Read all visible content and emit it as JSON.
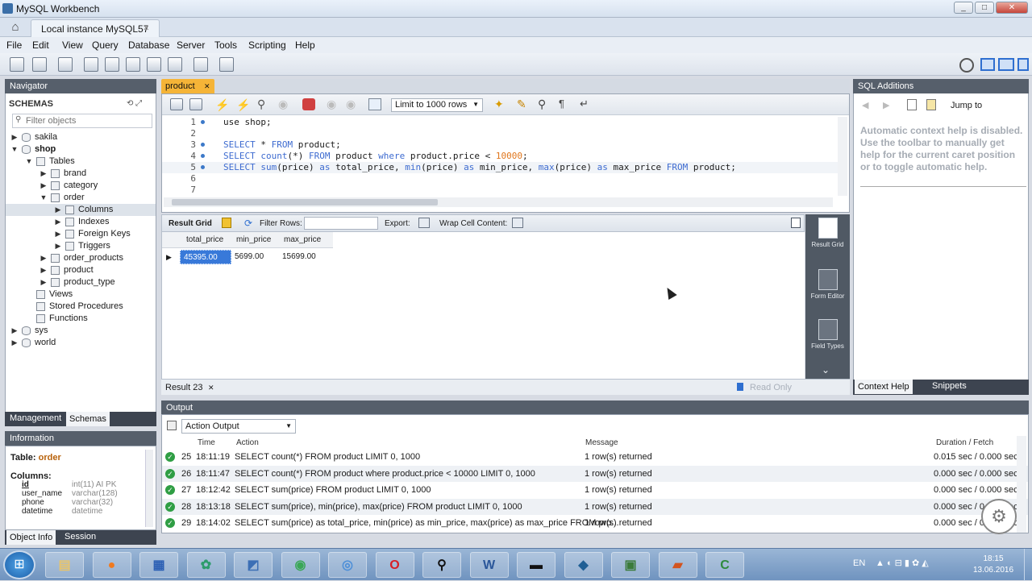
{
  "window": {
    "title": "MySQL Workbench",
    "min": "_",
    "max": "□",
    "close": "✕"
  },
  "conn_tab": {
    "label": "Local instance MySQL57",
    "close": "✕"
  },
  "menu": [
    "File",
    "Edit",
    "View",
    "Query",
    "Database",
    "Server",
    "Tools",
    "Scripting",
    "Help"
  ],
  "navigator": {
    "title": "Navigator",
    "schemas_label": "SCHEMAS",
    "filter_placeholder": "Filter objects",
    "tree": [
      {
        "label": "sakila",
        "depth": 0,
        "arrow": "▶",
        "bold": false
      },
      {
        "label": "shop",
        "depth": 0,
        "arrow": "▼",
        "bold": true
      },
      {
        "label": "Tables",
        "depth": 1,
        "arrow": "▼",
        "bold": false
      },
      {
        "label": "brand",
        "depth": 2,
        "arrow": "▶",
        "bold": false
      },
      {
        "label": "category",
        "depth": 2,
        "arrow": "▶",
        "bold": false
      },
      {
        "label": "order",
        "depth": 2,
        "arrow": "▼",
        "bold": false
      },
      {
        "label": "Columns",
        "depth": 3,
        "arrow": "▶",
        "bold": false,
        "selected": true
      },
      {
        "label": "Indexes",
        "depth": 3,
        "arrow": "▶",
        "bold": false
      },
      {
        "label": "Foreign Keys",
        "depth": 3,
        "arrow": "▶",
        "bold": false
      },
      {
        "label": "Triggers",
        "depth": 3,
        "arrow": "▶",
        "bold": false
      },
      {
        "label": "order_products",
        "depth": 2,
        "arrow": "▶",
        "bold": false
      },
      {
        "label": "product",
        "depth": 2,
        "arrow": "▶",
        "bold": false
      },
      {
        "label": "product_type",
        "depth": 2,
        "arrow": "▶",
        "bold": false
      },
      {
        "label": "Views",
        "depth": 1,
        "arrow": "",
        "bold": false
      },
      {
        "label": "Stored Procedures",
        "depth": 1,
        "arrow": "",
        "bold": false
      },
      {
        "label": "Functions",
        "depth": 1,
        "arrow": "",
        "bold": false
      },
      {
        "label": "sys",
        "depth": 0,
        "arrow": "▶",
        "bold": false
      },
      {
        "label": "world",
        "depth": 0,
        "arrow": "▶",
        "bold": false
      }
    ],
    "tabs": [
      "Management",
      "Schemas"
    ]
  },
  "information": {
    "title": "Information",
    "table_label": "Table:",
    "table_name": "order",
    "columns_label": "Columns:",
    "columns": [
      {
        "name": "id",
        "type": "int(11) AI PK"
      },
      {
        "name": "user_name",
        "type": "varchar(128)"
      },
      {
        "name": "phone",
        "type": "varchar(32)"
      },
      {
        "name": "datetime",
        "type": "datetime"
      }
    ],
    "tabs": [
      "Object Info",
      "Session"
    ]
  },
  "editor": {
    "tab_label": "product",
    "tab_close": "✕",
    "limit_select": "Limit to 1000 rows",
    "lines": [
      {
        "n": "1",
        "parts": [
          [
            "",
            "use shop;"
          ]
        ]
      },
      {
        "n": "2",
        "parts": []
      },
      {
        "n": "3",
        "parts": [
          [
            "kw",
            "SELECT"
          ],
          [
            "",
            " * "
          ],
          [
            "kw",
            "FROM"
          ],
          [
            "",
            " product;"
          ]
        ]
      },
      {
        "n": "4",
        "parts": [
          [
            "kw",
            "SELECT"
          ],
          [
            "",
            " "
          ],
          [
            "kw",
            "count"
          ],
          [
            "",
            "(*) "
          ],
          [
            "kw",
            "FROM"
          ],
          [
            "",
            " product "
          ],
          [
            "kw",
            "where"
          ],
          [
            "",
            " product.price < "
          ],
          [
            "num",
            "10000"
          ],
          [
            "",
            ";"
          ]
        ]
      },
      {
        "n": "5",
        "parts": [
          [
            "kw",
            "SELECT"
          ],
          [
            "",
            " "
          ],
          [
            "kw",
            "sum"
          ],
          [
            "",
            "(price) "
          ],
          [
            "kw",
            "as"
          ],
          [
            "",
            " total_price, "
          ],
          [
            "kw",
            "min"
          ],
          [
            "",
            "(price) "
          ],
          [
            "kw",
            "as"
          ],
          [
            "",
            " min_price, "
          ],
          [
            "kw",
            "max"
          ],
          [
            "",
            "(price) "
          ],
          [
            "kw",
            "as"
          ],
          [
            "",
            " max_price "
          ],
          [
            "kw",
            "FROM"
          ],
          [
            "",
            " product;"
          ]
        ]
      },
      {
        "n": "6",
        "parts": []
      },
      {
        "n": "7",
        "parts": []
      }
    ]
  },
  "result": {
    "toolbar": {
      "result_grid": "Result Grid",
      "filter_rows": "Filter Rows:",
      "export": "Export:",
      "wrap": "Wrap Cell Content:"
    },
    "columns": [
      "total_price",
      "min_price",
      "max_price"
    ],
    "row": [
      "45395.00",
      "5699.00",
      "15699.00"
    ],
    "tab_label": "Result 23",
    "tab_close": "✕",
    "read_only": "Read Only",
    "side": [
      "Result Grid",
      "Form Editor",
      "Field Types"
    ]
  },
  "sql_additions": {
    "title": "SQL Additions",
    "jump_to": "Jump to",
    "help_text": "Automatic context help is disabled. Use the toolbar to manually get help for the current caret position or to toggle automatic help.",
    "tabs": [
      "Context Help",
      "Snippets"
    ]
  },
  "output": {
    "title": "Output",
    "select": "Action Output",
    "headers": {
      "time": "Time",
      "action": "Action",
      "message": "Message",
      "duration": "Duration / Fetch"
    },
    "rows": [
      {
        "n": "25",
        "time": "18:11:19",
        "action": "SELECT count(*) FROM product LIMIT 0, 1000",
        "message": "1 row(s) returned",
        "duration": "0.015 sec / 0.000 sec"
      },
      {
        "n": "26",
        "time": "18:11:47",
        "action": "SELECT count(*) FROM product where product.price < 10000 LIMIT 0, 1000",
        "message": "1 row(s) returned",
        "duration": "0.000 sec / 0.000 sec"
      },
      {
        "n": "27",
        "time": "18:12:42",
        "action": "SELECT sum(price) FROM product LIMIT 0, 1000",
        "message": "1 row(s) returned",
        "duration": "0.000 sec / 0.000 sec"
      },
      {
        "n": "28",
        "time": "18:13:18",
        "action": "SELECT sum(price), min(price), max(price) FROM product LIMIT 0, 1000",
        "message": "1 row(s) returned",
        "duration": "0.000 sec / 0.000 sec"
      },
      {
        "n": "29",
        "time": "18:14:02",
        "action": "SELECT sum(price) as total_price, min(price) as min_price, max(price) as max_price FROM pro...",
        "message": "1 row(s) returned",
        "duration": "0.000 sec / 0.000 sec"
      }
    ]
  },
  "taskbar": {
    "apps": [
      {
        "name": "explorer-icon",
        "glyph": "▤",
        "color": "#e9c46a"
      },
      {
        "name": "firefox-icon",
        "glyph": "●",
        "color": "#f07a1f"
      },
      {
        "name": "calc-app-icon",
        "glyph": "▦",
        "color": "#2b5fb4"
      },
      {
        "name": "puzzle-app-icon",
        "glyph": "✿",
        "color": "#2d9c6c"
      },
      {
        "name": "workbench-icon",
        "glyph": "◩",
        "color": "#3c6fb5"
      },
      {
        "name": "chrome-icon",
        "glyph": "◉",
        "color": "#3aa757"
      },
      {
        "name": "search-app-icon",
        "glyph": "◎",
        "color": "#4d8fd8"
      },
      {
        "name": "opera-icon",
        "glyph": "O",
        "color": "#d81f26"
      },
      {
        "name": "keyhole-app-icon",
        "glyph": "⚲",
        "color": "#111111"
      },
      {
        "name": "word-icon",
        "glyph": "W",
        "color": "#2b579a"
      },
      {
        "name": "cmd-icon",
        "glyph": "▬",
        "color": "#111111"
      },
      {
        "name": "mysql-icon",
        "glyph": "◆",
        "color": "#1f5f95"
      },
      {
        "name": "monitor-app-icon",
        "glyph": "▣",
        "color": "#3b7b3b"
      },
      {
        "name": "presentation-app-icon",
        "glyph": "▰",
        "color": "#d2541f"
      },
      {
        "name": "c-app-icon",
        "glyph": "C",
        "color": "#2e8b3d"
      }
    ],
    "lang": "EN",
    "time": "18:15",
    "date": "13.06.2016"
  }
}
